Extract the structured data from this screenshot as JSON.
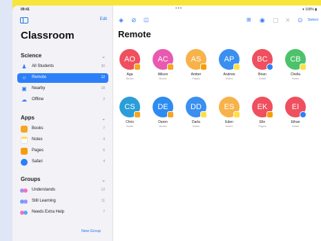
{
  "status": {
    "time": "09:41",
    "battery": "▾ 100% ▮"
  },
  "sidebar": {
    "edit": "Edit",
    "title": "Classroom",
    "section_science": "Science",
    "science_items": [
      {
        "label": "All Students",
        "count": "30",
        "icon": "person-icon"
      },
      {
        "label": "Remote",
        "count": "12",
        "icon": "remote-icon"
      },
      {
        "label": "Nearby",
        "count": "18",
        "icon": "nearby-icon"
      },
      {
        "label": "Offline",
        "count": "2",
        "icon": "offline-icon"
      }
    ],
    "section_apps": "Apps",
    "app_items": [
      {
        "label": "Books",
        "count": "7",
        "color": "#f5a623"
      },
      {
        "label": "Notes",
        "count": "4",
        "color": "#fde047"
      },
      {
        "label": "Pages",
        "count": "6",
        "color": "#f59e0b"
      },
      {
        "label": "Safari",
        "count": "4",
        "color": "#2d7ff9"
      }
    ],
    "section_groups": "Groups",
    "group_items": [
      {
        "label": "Understands",
        "count": "12"
      },
      {
        "label": "Still Learning",
        "count": "11"
      },
      {
        "label": "Needs Extra Help",
        "count": "7"
      }
    ],
    "new_group": "New Group"
  },
  "main": {
    "title": "Remote",
    "select": "Select",
    "students": [
      {
        "initials": "AO",
        "name": "Aga",
        "app": "Books",
        "color": "#ef4f5e",
        "badge": "#f5a623"
      },
      {
        "initials": "AC",
        "name": "Allison",
        "app": "Books",
        "color": "#e859b0",
        "badge": "#f5a623"
      },
      {
        "initials": "AS",
        "name": "Amber",
        "app": "Pages",
        "color": "#f7b24a",
        "badge": "#f59e0b"
      },
      {
        "initials": "AP",
        "name": "Andrew",
        "app": "Notes",
        "color": "#3a8ff0",
        "badge": "#fde047"
      },
      {
        "initials": "BC",
        "name": "Brian",
        "app": "Safari",
        "color": "#ef4f5e",
        "badge": "#2d7ff9"
      },
      {
        "initials": "CB",
        "name": "Chella",
        "app": "Notes",
        "color": "#4cc36b",
        "badge": "#fde047"
      },
      {
        "initials": "CS",
        "name": "Chris",
        "app": "Safari",
        "color": "#2b9ed8",
        "badge": "#f5a623"
      },
      {
        "initials": "DE",
        "name": "Daren",
        "app": "Books",
        "color": "#2d8cf0",
        "badge": "#f5a623"
      },
      {
        "initials": "DD",
        "name": "Darla",
        "app": "Notes",
        "color": "#3a8ff0",
        "badge": "#fde047"
      },
      {
        "initials": "ES",
        "name": "Eden",
        "app": "Notes",
        "color": "#f7b24a",
        "badge": "#fde047"
      },
      {
        "initials": "EK",
        "name": "Elle",
        "app": "Pages",
        "color": "#ef4f5e",
        "badge": "#f59e0b"
      },
      {
        "initials": "EI",
        "name": "Ethan",
        "app": "Safari",
        "color": "#ef4f5e",
        "badge": "#2d7ff9"
      }
    ]
  }
}
